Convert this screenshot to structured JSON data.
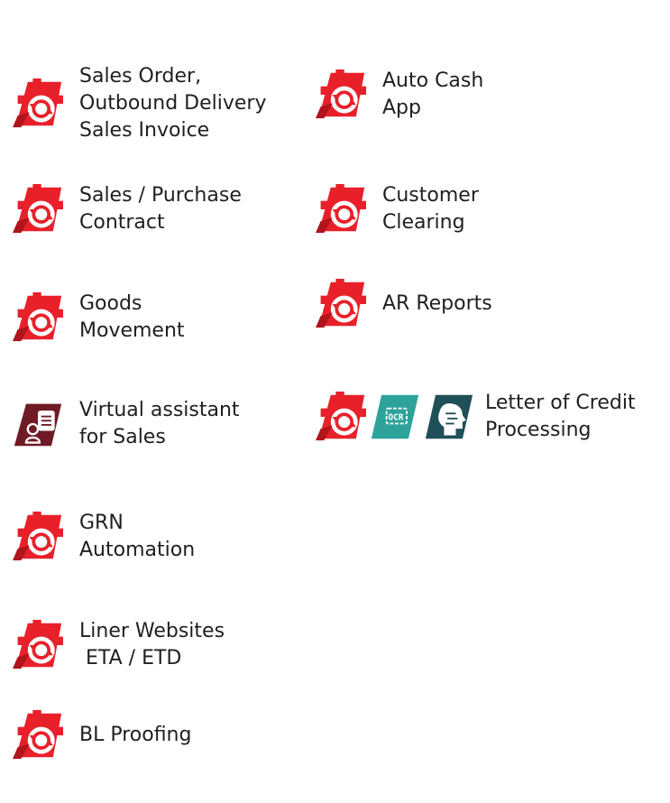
{
  "colors": {
    "rpa_red": "#e8202a",
    "rpa_dark": "#8e1f1f",
    "assistant_bg": "#6f1b26",
    "ocr_teal": "#2ea39a",
    "ai_teal": "#1f4f57"
  },
  "items": [
    {
      "lines": [
        "Sales Order,",
        "Outbound Delivery",
        "Sales Invoice"
      ],
      "icons": [
        "rpa-gear-icon"
      ]
    },
    {
      "lines": [
        "Auto Cash",
        "App"
      ],
      "icons": [
        "rpa-gear-icon"
      ]
    },
    {
      "lines": [
        "Sales / Purchase",
        "Contract"
      ],
      "icons": [
        "rpa-gear-icon"
      ]
    },
    {
      "lines": [
        "Customer",
        "Clearing"
      ],
      "icons": [
        "rpa-gear-icon"
      ]
    },
    {
      "lines": [
        "Goods",
        "Movement"
      ],
      "icons": [
        "rpa-gear-icon"
      ]
    },
    {
      "lines": [
        "AR Reports"
      ],
      "icons": [
        "rpa-gear-icon"
      ]
    },
    {
      "lines": [
        "Virtual assistant",
        "for Sales"
      ],
      "icons": [
        "virtual-assistant-icon"
      ]
    },
    {
      "lines": [
        "Letter of Credit",
        "Processing"
      ],
      "icons": [
        "rpa-gear-icon",
        "ocr-icon",
        "ai-head-icon"
      ]
    },
    {
      "lines": [
        "GRN",
        "Automation"
      ],
      "icons": [
        "rpa-gear-icon"
      ]
    },
    {
      "lines": [
        "Liner Websites",
        " ETA / ETD"
      ],
      "icons": [
        "rpa-gear-icon"
      ]
    },
    {
      "lines": [
        "BL Proofing"
      ],
      "icons": [
        "rpa-gear-icon"
      ]
    }
  ]
}
